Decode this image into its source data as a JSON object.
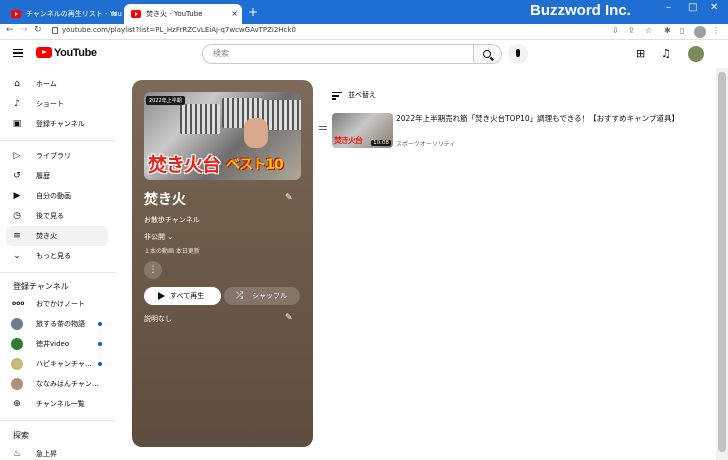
{
  "browser": {
    "tabs": [
      {
        "title": "チャンネルの再生リスト - YouTube S",
        "active": false
      },
      {
        "title": "焚き火 - YouTube",
        "active": true
      }
    ],
    "new_tab": "+",
    "brand": "Buzzword Inc.",
    "address": "youtube.com/playlist?list=PL_HzFrRZCvLEiAj-q7wcwGAvTPZi2Hck0",
    "profile_initials": "⚲"
  },
  "header": {
    "logo_text": "YouTube",
    "search_placeholder": "検索"
  },
  "sidebar": {
    "main": [
      {
        "label": "ホーム",
        "icon": "home-icon",
        "glyph": "⌂"
      },
      {
        "label": "ショート",
        "icon": "shorts-icon",
        "glyph": "♪"
      },
      {
        "label": "登録チャンネル",
        "icon": "subscriptions-icon",
        "glyph": "▣"
      }
    ],
    "library": [
      {
        "label": "ライブラリ",
        "icon": "library-icon",
        "glyph": "▷"
      },
      {
        "label": "履歴",
        "icon": "history-icon",
        "glyph": "↺"
      },
      {
        "label": "自分の動画",
        "icon": "my-videos-icon",
        "glyph": "▶"
      },
      {
        "label": "後で見る",
        "icon": "watch-later-icon",
        "glyph": "◷"
      },
      {
        "label": "焚き火",
        "icon": "playlist-icon",
        "glyph": "≡"
      },
      {
        "label": "もっと見る",
        "icon": "chevron-down-icon",
        "glyph": "⌄"
      }
    ],
    "subscriptions_heading": "登録チャンネル",
    "subscriptions": [
      {
        "label": "おでかけノート",
        "dot": false,
        "color": "#555555"
      },
      {
        "label": "旅する茶の物語",
        "dot": true,
        "color": "#6d7b8a"
      },
      {
        "label": "徳井video",
        "dot": true,
        "color": "#2e7d32"
      },
      {
        "label": "ハピキャンチャ…",
        "dot": true,
        "color": "#c9b87a"
      },
      {
        "label": "ななみはんチャン…",
        "dot": false,
        "color": "#b08f7a"
      },
      {
        "label": "チャンネル一覧",
        "dot": false,
        "color": ""
      }
    ],
    "explore_heading": "探索",
    "explore": [
      {
        "label": "急上昇",
        "icon": "trending-icon",
        "glyph": "♨"
      }
    ]
  },
  "playlist": {
    "thumb_badge": "2022年上半期",
    "thumb_title_red": "焚き火台",
    "thumb_title_yellow": "ベスト10",
    "title": "焚き火",
    "owner": "お散歩チャンネル",
    "privacy": "非公開",
    "meta": "１本の動画  本日更新",
    "play_all": "すべて再生",
    "shuffle": "シャッフル",
    "description": "説明なし"
  },
  "sort_label": "並べ替え",
  "videos": [
    {
      "title": "2022年上半期売れ筋「焚き火台TOP10」調理もできる！【おすすめキャンプ道具】",
      "channel": "スポーツオーソリティ",
      "duration": "10:08",
      "thumb_text": "焚き火台"
    }
  ],
  "colors": {
    "tabbar": "#1f6fd2",
    "playlist_panel": "#6f5d4c",
    "youtube_red": "#ff0000"
  }
}
